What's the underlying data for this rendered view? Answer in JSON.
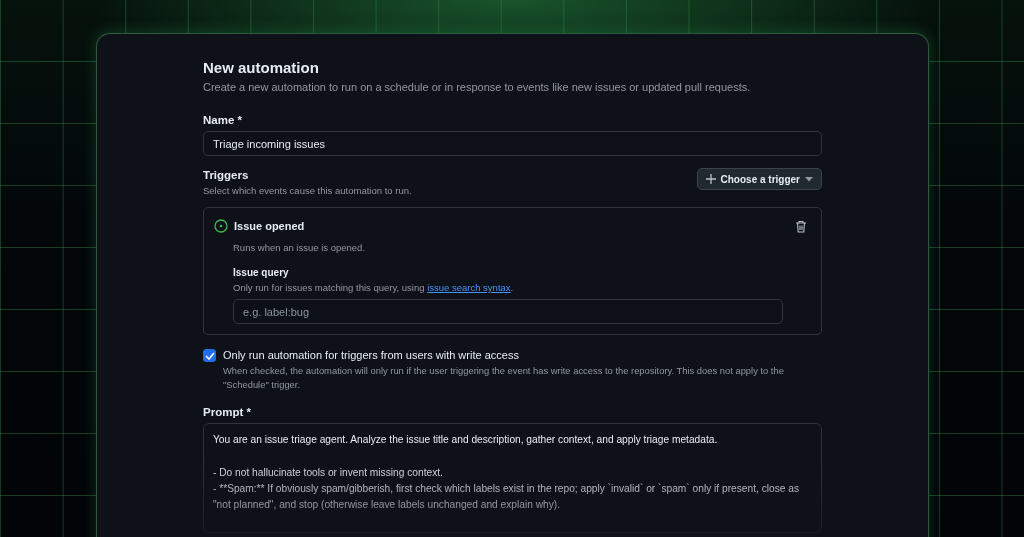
{
  "title": "New automation",
  "subtitle": "Create a new automation to run on a schedule or in response to events like new issues or updated pull requests.",
  "name_field": {
    "label": "Name *",
    "value": "Triage incoming issues"
  },
  "triggers": {
    "label": "Triggers",
    "description": "Select which events cause this automation to run.",
    "button": "Choose a trigger",
    "items": [
      {
        "title": "Issue opened",
        "description": "Runs when an issue is opened.",
        "query_label": "Issue query",
        "query_help": "Only run for issues matching this query, using ",
        "query_link": "issue search syntax",
        "query_help_end": ".",
        "query_placeholder": "e.g. label:bug"
      }
    ]
  },
  "write_access": {
    "label": "Only run automation for triggers from users with write access",
    "checked": true,
    "description": "When checked, the automation will only run if the user triggering the event has write access to the repository. This does not apply to the \"Schedule\" trigger."
  },
  "prompt": {
    "label": "Prompt *",
    "value": "You are an issue triage agent. Analyze the issue title and description, gather context, and apply triage metadata.\n\n- Do not hallucinate tools or invent missing context.\n- **Spam:** If obviously spam/gibberish, first check which labels exist in the repo; apply `invalid` or `spam` only if present, close as \"not planned\", and stop (otherwise leave labels unchanged and explain why)."
  }
}
